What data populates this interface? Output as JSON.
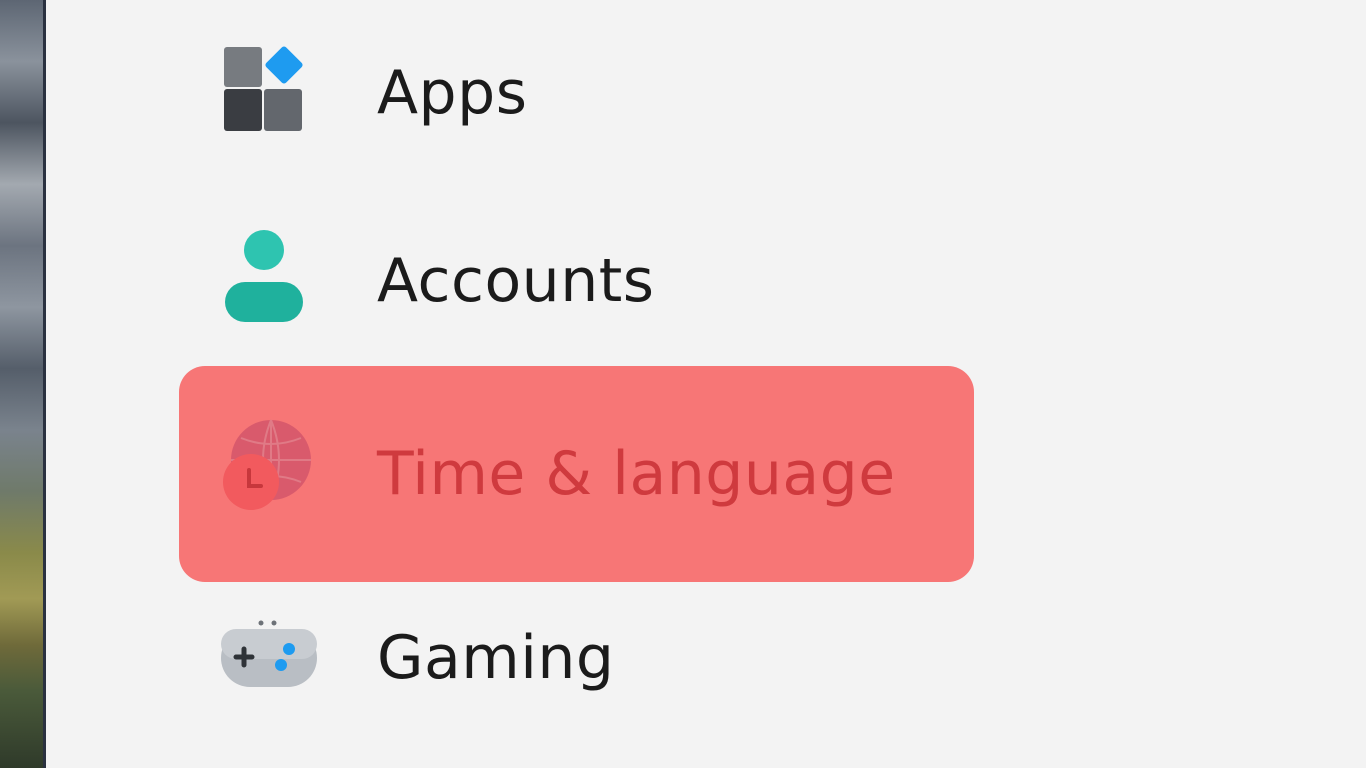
{
  "sidebar": {
    "items": [
      {
        "label": "Apps",
        "icon": "apps-icon"
      },
      {
        "label": "Accounts",
        "icon": "accounts-icon"
      },
      {
        "label": "Time & language",
        "icon": "time-language-icon",
        "highlighted": true
      },
      {
        "label": "Gaming",
        "icon": "gaming-icon"
      }
    ]
  },
  "colors": {
    "background": "#f3f3f3",
    "highlight": "#f77676",
    "highlight_text": "#cf3a3e",
    "text": "#1b1b1b",
    "accounts_icon": "#22b8a4",
    "apps_accent": "#1e9bf0"
  }
}
